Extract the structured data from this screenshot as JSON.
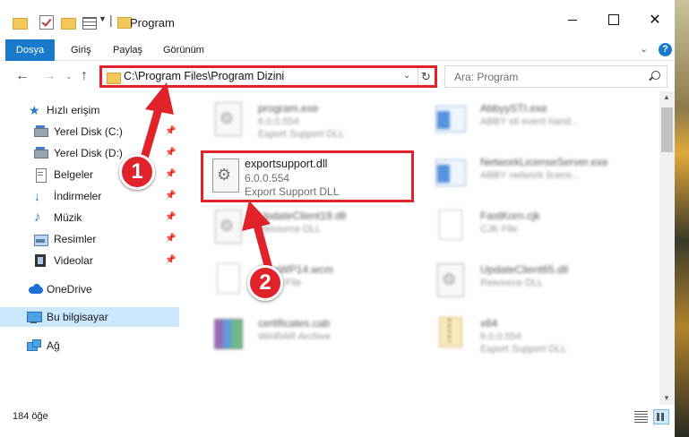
{
  "window": {
    "title": "Program",
    "colors": {
      "accent": "#1979ca",
      "annotation": "#e0232b",
      "selected": "#cce8ff"
    }
  },
  "ribbon": {
    "tabs": [
      {
        "label": "Dosya"
      },
      {
        "label": "Giriş"
      },
      {
        "label": "Paylaş"
      },
      {
        "label": "Görünüm"
      }
    ],
    "help": "?"
  },
  "nav": {
    "address": "C:\\Program Files\\Program Dizini",
    "search_placeholder": "Ara: Program"
  },
  "sidebar": {
    "items": [
      {
        "label": "Hızlı erişim",
        "icon": "star-icon"
      },
      {
        "label": "Yerel Disk (C:)",
        "icon": "disk-icon",
        "pinned": true
      },
      {
        "label": "Yerel Disk (D:)",
        "icon": "disk-icon",
        "pinned": true
      },
      {
        "label": "Belgeler",
        "icon": "document-icon",
        "pinned": true
      },
      {
        "label": "İndirmeler",
        "icon": "download-icon",
        "pinned": true
      },
      {
        "label": "Müzik",
        "icon": "music-icon",
        "pinned": true
      },
      {
        "label": "Resimler",
        "icon": "pictures-icon",
        "pinned": true
      },
      {
        "label": "Videolar",
        "icon": "video-icon",
        "pinned": true
      },
      {
        "label": "OneDrive",
        "icon": "cloud-icon"
      },
      {
        "label": "Bu bilgisayar",
        "icon": "computer-icon",
        "selected": true
      },
      {
        "label": "Ağ",
        "icon": "network-icon"
      }
    ]
  },
  "files": [
    {
      "name": "program.exe",
      "line2": "6.0.0.554",
      "line3": "Export Support DLL",
      "icon": "dll-icon"
    },
    {
      "name": "AbbyySTI.exe",
      "line2": "ABBY sti event hand...",
      "line3": "",
      "icon": "exe-icon"
    },
    {
      "name": "exportsupport.dll",
      "line2": "6.0.0.554",
      "line3": "Export Support DLL",
      "icon": "dll-icon"
    },
    {
      "name": "NetworkLicenseServer.exe",
      "line2": "ABBY network licens...",
      "line3": "",
      "icon": "exe-icon"
    },
    {
      "name": "UpdateClient19.dll",
      "line2": "Resource DLL",
      "line3": "",
      "icon": "dll-icon"
    },
    {
      "name": "FastKorn.cjk",
      "line2": "CJK File",
      "line3": "",
      "icon": "page-icon"
    },
    {
      "name": "SlimWP14.wcm",
      "line2": "WCM File",
      "line3": "",
      "icon": "page-icon"
    },
    {
      "name": "UpdateClient65.dll",
      "line2": "Resource DLL",
      "line3": "",
      "icon": "dll-icon"
    },
    {
      "name": "certificates.cab",
      "line2": "WinRAR Archive",
      "line3": "",
      "icon": "cab-icon"
    },
    {
      "name": "x64",
      "line2": "6.0.0.554",
      "line3": "Export Support DLL",
      "icon": "zip-icon"
    }
  ],
  "status": {
    "count": "184 öğe"
  },
  "annotations": {
    "step1": "1",
    "step2": "2"
  }
}
